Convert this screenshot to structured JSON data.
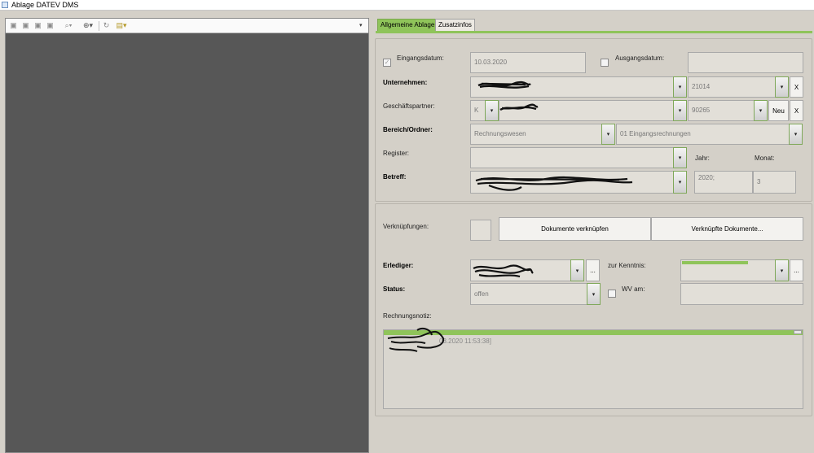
{
  "window": {
    "title": "Ablage DATEV DMS"
  },
  "tabs": [
    {
      "label": "Allgemeine Ablage",
      "active": true
    },
    {
      "label": "Zusatzinfos",
      "active": false
    }
  ],
  "form": {
    "eingangsdatum": {
      "label": "Eingangsdatum:",
      "value": "10.03.2020",
      "checked": true
    },
    "ausgangsdatum": {
      "label": "Ausgangsdatum:",
      "value": "",
      "checked": false
    },
    "unternehmen": {
      "label": "Unternehmen:",
      "number": "21014",
      "clear_label": "X"
    },
    "geschaeftspartner": {
      "label": "Geschäftspartner:",
      "type": "K",
      "number": "90265",
      "new_label": "Neu",
      "clear_label": "X"
    },
    "bereich_ordner": {
      "label": "Bereich/Ordner:",
      "bereich": "Rechnungswesen",
      "ordner": "01 Eingangsrechnungen"
    },
    "register": {
      "label": "Register:",
      "value": ""
    },
    "jahr": {
      "label": "Jahr:",
      "value": "2020;"
    },
    "monat": {
      "label": "Monat:",
      "value": "3"
    },
    "betreff": {
      "label": "Betreff:"
    }
  },
  "links": {
    "label": "Verknüpfungen:",
    "link_button": "Dokumente verknüpfen",
    "linked_button": "Verknüpfte Dokumente..."
  },
  "workflow": {
    "erlediger": {
      "label": "Erlediger:",
      "more_label": "..."
    },
    "zur_kenntnis": {
      "label": "zur Kenntnis:",
      "more_label": "...",
      "progress": 0.7
    },
    "status": {
      "label": "Status:",
      "value": "offen"
    },
    "wv_am": {
      "label": "WV am:",
      "value": "",
      "checked": false
    }
  },
  "rechnungsnotiz": {
    "label": "Rechnungsnotiz:",
    "entry_visible": "03.2020 11:53:38]"
  },
  "colors": {
    "accent": "#8fc45a",
    "viewer_bg": "#575757",
    "panel_bg": "#d4d0c8"
  },
  "icons": [
    "page-first-icon",
    "page-prev-icon",
    "page-next-icon",
    "page-last-icon",
    "search-icon",
    "zoom-icon",
    "rotate-icon",
    "paste-icon"
  ]
}
